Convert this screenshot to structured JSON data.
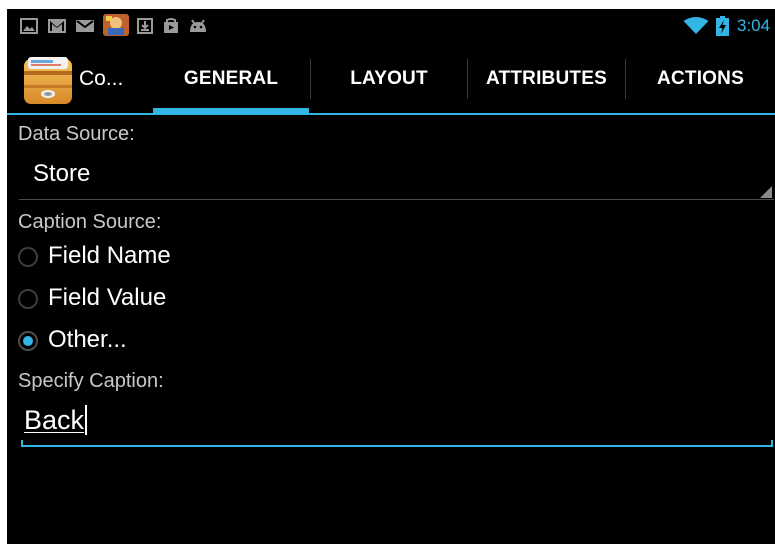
{
  "status_bar": {
    "time": "3:04",
    "notification_icons": [
      "gallery-icon",
      "gmail-icon",
      "email-icon",
      "game-app-icon",
      "download-icon",
      "play-store-icon",
      "android-icon"
    ],
    "system_icons": [
      "wifi-icon",
      "battery-charging-icon"
    ]
  },
  "action_bar": {
    "app_title": "Co...",
    "app_icon": "drawer-cabinet-icon",
    "tabs": [
      {
        "label": "GENERAL",
        "selected": true
      },
      {
        "label": "LAYOUT",
        "selected": false
      },
      {
        "label": "ATTRIBUTES",
        "selected": false
      },
      {
        "label": "ACTIONS",
        "selected": false
      }
    ]
  },
  "form": {
    "data_source_label": "Data Source:",
    "data_source_value": "Store",
    "caption_source_label": "Caption Source:",
    "caption_options": [
      {
        "label": "Field Name",
        "checked": false
      },
      {
        "label": "Field Value",
        "checked": false
      },
      {
        "label": "Other...",
        "checked": true
      }
    ],
    "specify_caption_label": "Specify Caption:",
    "caption_value": "Back"
  },
  "colors": {
    "accent": "#33b5e5",
    "background": "#000000",
    "label_text": "#c8c8c8",
    "text": "#ffffff"
  }
}
